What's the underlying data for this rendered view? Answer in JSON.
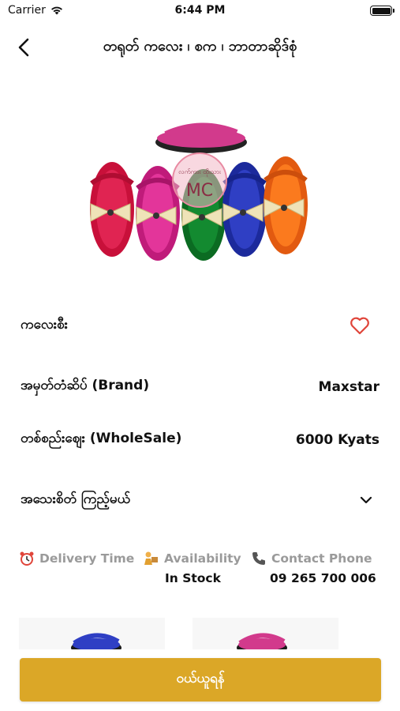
{
  "status_bar": {
    "carrier": "Carrier",
    "time": "6:44 PM"
  },
  "header": {
    "title": "တရုတ် ကလေး ၊ စက ၊ ဘာတာဆိုဒ်စုံ"
  },
  "product_image": {
    "logo_text": "MC",
    "logo_subtext": "လက်ကား ထိုးသား"
  },
  "details": {
    "category": {
      "label": "ကလေးစီး"
    },
    "brand": {
      "label": "အမှတ်တံဆိပ် (Brand)",
      "value": "Maxstar"
    },
    "wholesale": {
      "label": "တစ်စည်းဈေး (WholeSale)",
      "value": "6000 Kyats"
    },
    "more": {
      "label": "အသေးစိတ် ကြည့်မယ်"
    }
  },
  "info": {
    "delivery": {
      "label": "Delivery Time",
      "value": ""
    },
    "availability": {
      "label": "Availability",
      "value": "In Stock"
    },
    "contact": {
      "label": "Contact Phone",
      "value": "09 265 700 006"
    }
  },
  "buy_button": {
    "label": "ဝယ်ယူရန်"
  },
  "colors": {
    "accent": "#dba727",
    "heart": "#e0453a",
    "muted": "#9a9a9a"
  }
}
